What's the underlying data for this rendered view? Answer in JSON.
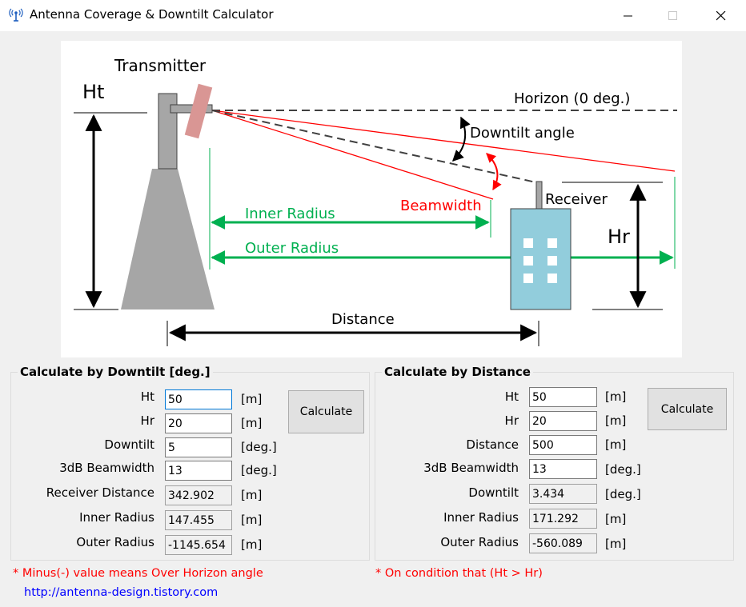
{
  "window": {
    "title": "Antenna Coverage & Downtilt Calculator",
    "icon": "antenna-icon"
  },
  "diagram": {
    "transmitter": "Transmitter",
    "ht": "Ht",
    "hr": "Hr",
    "horizon": "Horizon (0 deg.)",
    "downtilt_angle": "Downtilt angle",
    "beamwidth": "Beamwidth",
    "receiver": "Receiver",
    "inner_radius": "Inner Radius",
    "outer_radius": "Outer Radius",
    "distance": "Distance",
    "colors": {
      "beam": "#ff0000",
      "radius": "#00b050",
      "building": "#92cddc",
      "tower": "#a6a6a6",
      "antenna": "#d99694"
    }
  },
  "left": {
    "title": "Calculate by Downtilt [deg.]",
    "button": "Calculate",
    "rows": [
      {
        "label": "Ht",
        "value": "50",
        "unit": "[m]"
      },
      {
        "label": "Hr",
        "value": "20",
        "unit": "[m]"
      },
      {
        "label": "Downtilt",
        "value": "5",
        "unit": "[deg.]"
      },
      {
        "label": "3dB Beamwidth",
        "value": "13",
        "unit": "[deg.]"
      },
      {
        "label": "Receiver Distance",
        "value": "342.902",
        "unit": "[m]"
      },
      {
        "label": "Inner Radius",
        "value": "147.455",
        "unit": "[m]"
      },
      {
        "label": "Outer Radius",
        "value": "-1145.654",
        "unit": "[m]"
      }
    ]
  },
  "right": {
    "title": "Calculate by Distance",
    "button": "Calculate",
    "rows": [
      {
        "label": "Ht",
        "value": "50",
        "unit": "[m]"
      },
      {
        "label": "Hr",
        "value": "20",
        "unit": "[m]"
      },
      {
        "label": "Distance",
        "value": "500",
        "unit": "[m]"
      },
      {
        "label": "3dB Beamwidth",
        "value": "13",
        "unit": "[deg.]"
      },
      {
        "label": "Downtilt",
        "value": "3.434",
        "unit": "[deg.]"
      },
      {
        "label": "Inner Radius",
        "value": "171.292",
        "unit": "[m]"
      },
      {
        "label": "Outer Radius",
        "value": "-560.089",
        "unit": "[m]"
      }
    ]
  },
  "notes": {
    "left": "* Minus(-) value means Over Horizon angle",
    "right": "* On condition that (Ht > Hr)",
    "link": "http://antenna-design.tistory.com"
  }
}
